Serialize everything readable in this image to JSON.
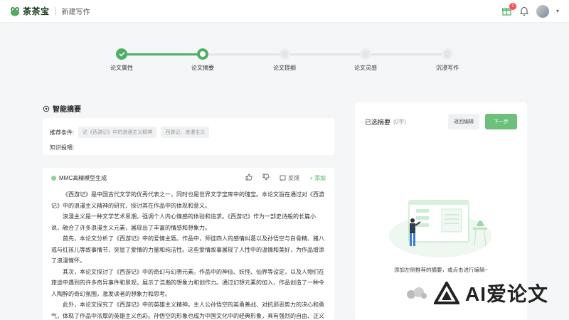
{
  "header": {
    "logo_text": "茶茶宝",
    "page_title": "新建写作",
    "notification_count": "1"
  },
  "steps": [
    {
      "label": "论文属性",
      "status": "done"
    },
    {
      "label": "论文摘要",
      "status": "current"
    },
    {
      "label": "论文提纲",
      "status": "todo"
    },
    {
      "label": "论文灵感",
      "status": "todo"
    },
    {
      "label": "沉浸写作",
      "status": "todo"
    }
  ],
  "section_title": "智能摘要",
  "conditions": {
    "label": "推荐条件:",
    "tags": [
      "论《西游记》中的浪漫主义精神",
      "西游记、浪漫主义"
    ],
    "knowledge_label": "知识投喂:"
  },
  "generated": {
    "source": "MMC高精模型生成",
    "feedback": "反馈",
    "add": "+ 添加",
    "paragraphs": [
      "《西游记》是中国古代文学的优秀代表之一，同时也是世界文学宝库中的瑰宝。本论文旨在通过对《西游记》中的浪漫主义精神的研究，探讨其在作品中的体现和意义。",
      "浪漫主义是一种文学艺术思潮，强调个人内心情感的体验和追求。《西游记》作为一部史诗般的长篇小说，融合了许多浪漫主义元素，展现出了丰富的情感和想象力。",
      "首先，本论文分析了《西游记》中的爱情主题。作品中，师徒四人的感情纠葛以及孙悟空与白骨精、猪八戒与红孩儿等故事情节，突显了爱情的力量和纯洁性。这些爱情故事展现了人性中的温情和美好，为作品增添了浪漫情怀。",
      "其次，本论文探讨了《西游记》中的奇幻与幻想元素。作品中的神仙、妖怪、仙界等设定，以及人物们在旅途中遇到的许多奇异事件和景观，展示了浩瀚的想象力和创作力。通过幻想元素的加入，作品创造了一种令人陶醉的奇幻氛围，激发读者的想象力和思考。",
      "此外，本论文探究了《西游记》中的英雄主义精神。主人公孙悟空的英勇善战、对抗邪恶势力的决心和勇气，体现了作品中浓厚的英雄主义色彩。孙悟空的形象也成为中国文化中的经典形象，具有强烈的自由、正义"
    ]
  },
  "right_panel": {
    "title": "已选摘要",
    "count": "(0字)",
    "back_button": "返回编辑",
    "next_button": "下一步",
    "hint": "添加左侧推荐的摘要，或点击进行编辑~"
  },
  "watermark": "AI爱论文",
  "colors": {
    "accent": "#4caf63",
    "badge": "#ff4d4f"
  }
}
